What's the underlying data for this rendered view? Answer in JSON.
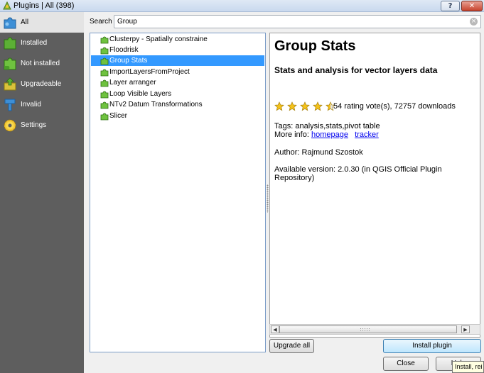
{
  "window": {
    "title": "Plugins | All (398)",
    "help_label": "?",
    "close_label": "✕"
  },
  "sidebar": {
    "items": [
      {
        "label": "All",
        "icon": "puzzle-blue-icon"
      },
      {
        "label": "Installed",
        "icon": "puzzle-green-icon"
      },
      {
        "label": "Not installed",
        "icon": "puzzle-green-icon"
      },
      {
        "label": "Upgradeable",
        "icon": "puzzle-upgrade-icon"
      },
      {
        "label": "Invalid",
        "icon": "invalid-plugin-icon"
      },
      {
        "label": "Settings",
        "icon": "gear-icon"
      }
    ]
  },
  "search": {
    "label": "Search",
    "value": "Group",
    "clear_icon": "clear-icon"
  },
  "plugin_list": {
    "items": [
      "Clusterpy - Spatially constraine",
      "Floodrisk",
      "Group Stats",
      "ImportLayersFromProject",
      "Layer arranger",
      "Loop Visible Layers",
      "NTv2 Datum Transformations",
      "Slicer"
    ],
    "selected_index": 2
  },
  "details": {
    "title": "Group Stats",
    "subtitle": "Stats and analysis for vector layers data",
    "rating": 4.5,
    "rating_max": 5,
    "votes_text": "54 rating vote(s), 72757 downloads",
    "tags_text": "Tags: analysis,stats,pivot table",
    "more_info_label": "More info:",
    "homepage_link": "homepage",
    "tracker_link": "tracker",
    "author_text": "Author: Rajmund Szostok",
    "version_line1": "Available version: 2.0.30 (in QGIS Official Plugin",
    "version_line2": "Repository)"
  },
  "buttons": {
    "upgrade_all": "Upgrade all",
    "install_plugin": "Install plugin",
    "close": "Close",
    "help": "Help"
  },
  "tooltip": {
    "text": "Install, rei"
  },
  "colors": {
    "sidebar_bg": "#5e5e5e",
    "selection": "#3399ff",
    "link": "#0000ee",
    "star": "#f4c21a"
  }
}
